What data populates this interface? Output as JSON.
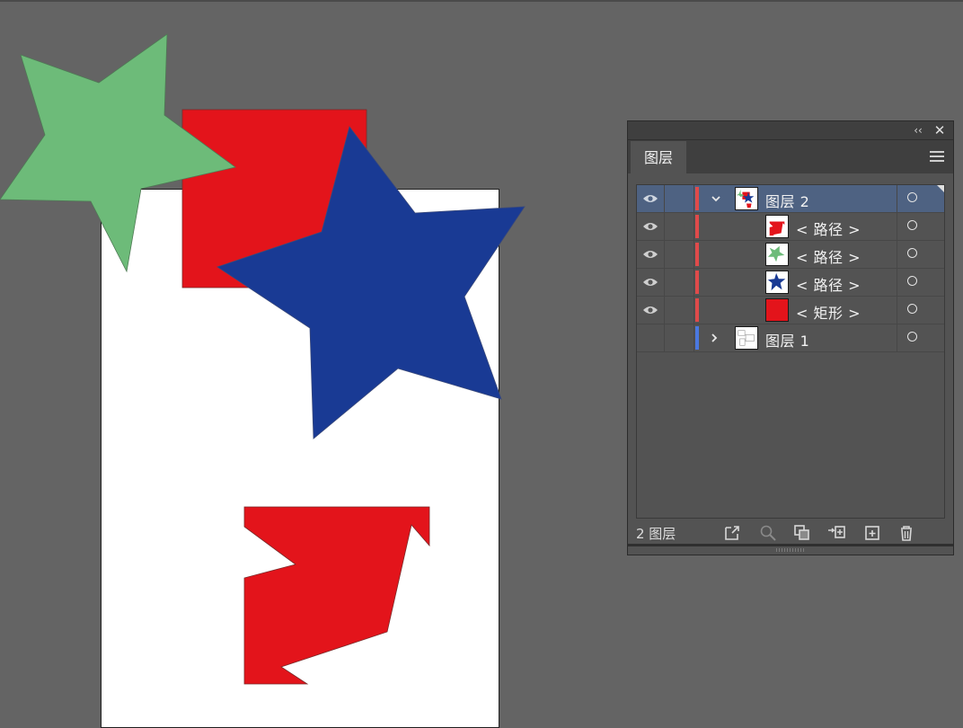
{
  "canvas": {
    "background": "#646464",
    "artboard_color": "#ffffff",
    "shape_colors": {
      "red": "#e3141b",
      "green": "#6dbb79",
      "blue": "#193a94"
    }
  },
  "panel": {
    "tab_label": "图层",
    "collapse_icon": "double-chevron-left-icon",
    "close_icon": "close-icon",
    "menu_icon": "hamburger-menu-icon",
    "layers": [
      {
        "label": "图层 2",
        "expanded": true,
        "selected": true,
        "color": "#e04a4a",
        "thumbnail": "layer-2-thumbnail",
        "visible": true
      },
      {
        "label": "< 路径 >",
        "indent": true,
        "color": "#e04a4a",
        "thumbnail": "red-shape-thumbnail",
        "visible": true
      },
      {
        "label": "< 路径 >",
        "indent": true,
        "color": "#e04a4a",
        "thumbnail": "green-star-thumbnail",
        "visible": true
      },
      {
        "label": "< 路径 >",
        "indent": true,
        "color": "#e04a4a",
        "thumbnail": "blue-star-thumbnail",
        "visible": true
      },
      {
        "label": "< 矩形 >",
        "indent": true,
        "color": "#e04a4a",
        "thumbnail": "red-rectangle-thumbnail",
        "visible": true
      },
      {
        "label": "图层 1",
        "expanded": false,
        "selected": false,
        "color": "#4a78e0",
        "thumbnail": "layer-1-thumbnail",
        "visible": false
      }
    ],
    "footer": {
      "count_label": "2 图层",
      "buttons": [
        "export-icon",
        "search-icon",
        "clipping-mask-icon",
        "new-sublayer-icon",
        "new-layer-icon",
        "trash-icon"
      ]
    }
  }
}
